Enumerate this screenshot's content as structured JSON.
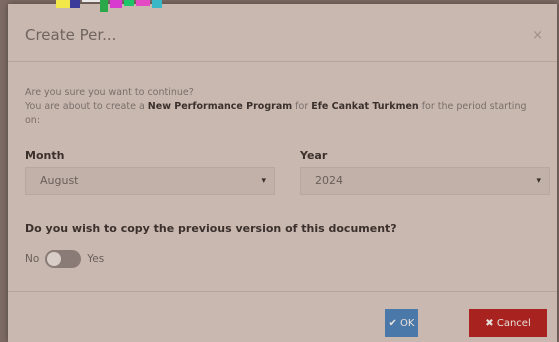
{
  "dialog": {
    "title": "Create Per...",
    "confirm_text": "Are you sure you want to continue?",
    "desc_prefix": "You are about to create a",
    "program": "New Performance Program",
    "for": "for",
    "employee": "Efe Cankat Turkmen",
    "desc_suffix": "for the period starting on:"
  },
  "form": {
    "month_label": "Month",
    "month_value": "August",
    "year_label": "Year",
    "year_value": "2024",
    "copy_question": "Do you wish to copy the previous version of this document?",
    "toggle_off_label": "No",
    "toggle_on_label": "Yes"
  },
  "buttons": {
    "ok_label": "✔ OK",
    "cancel_label": "✖ Cancel"
  },
  "colors": {
    "ok": "#4a78a8",
    "cancel": "#a8231f",
    "backdrop": "#7d6a64"
  }
}
